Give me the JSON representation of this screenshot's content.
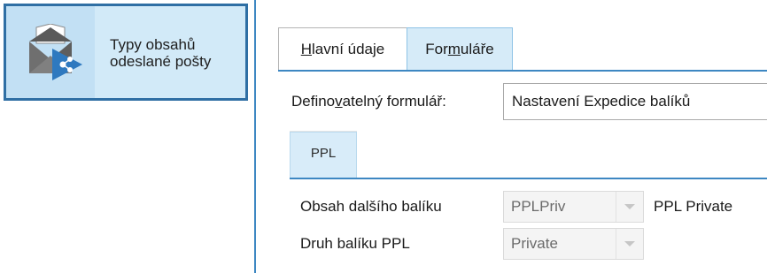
{
  "sidebar": {
    "item": {
      "label": "Typy obsahů odeslané pošty",
      "icon": "open-envelope-with-arrow-icon"
    }
  },
  "tabs": [
    {
      "pre": "",
      "ul": "H",
      "post": "lavní údaje",
      "active": false
    },
    {
      "pre": "For",
      "ul": "m",
      "post": "uláře",
      "active": true
    }
  ],
  "form": {
    "label_pre": "Defino",
    "label_ul": "v",
    "label_post": "atelný formulář:",
    "value": "Nastavení Expedice balíků"
  },
  "subtab": {
    "label": "PPL"
  },
  "fields": [
    {
      "label": "Obsah dalšího balíku",
      "value": "PPLPriv",
      "description": "PPL Private"
    },
    {
      "label": "Druh balíku PPL",
      "value": "Private",
      "description": ""
    }
  ],
  "colors": {
    "accent": "#3d87c2",
    "nav_selected_bg": "#d2eaf8",
    "active_tab_bg": "#d6ebf8"
  }
}
